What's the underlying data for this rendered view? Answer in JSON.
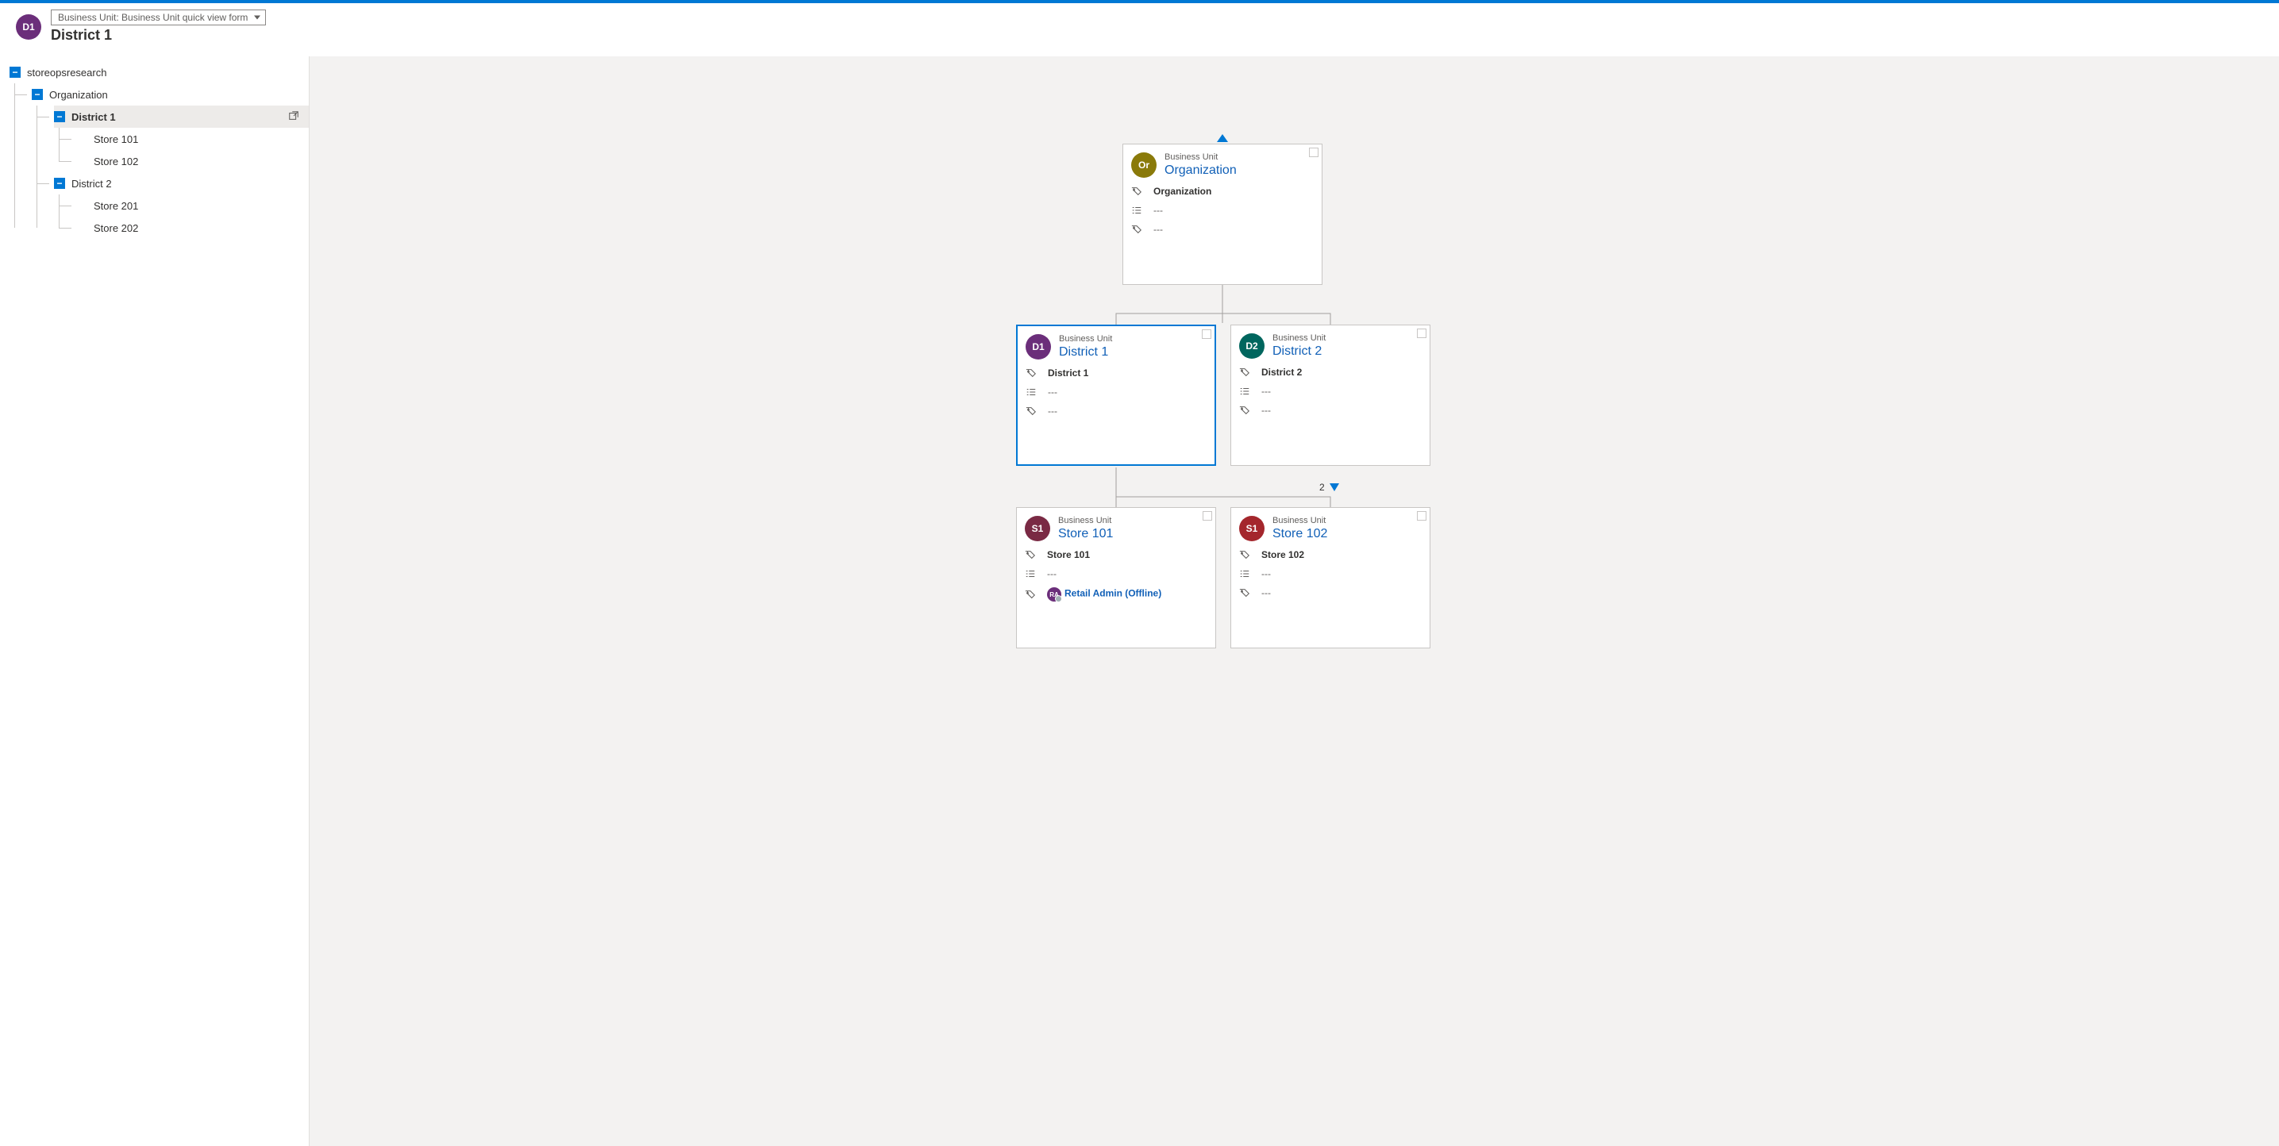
{
  "header": {
    "avatar_initials": "D1",
    "form_selector": "Business Unit: Business Unit quick view form",
    "title": "District 1"
  },
  "tree": {
    "root": "storeopsresearch",
    "organization": "Organization",
    "district1": "District 1",
    "store101": "Store 101",
    "store102": "Store 102",
    "district2": "District 2",
    "store201": "Store 201",
    "store202": "Store 202"
  },
  "hierarchy": {
    "type_label": "Business Unit",
    "dash": "---",
    "organization": {
      "initials": "Or",
      "title": "Organization",
      "name_value": "Organization"
    },
    "district1": {
      "initials": "D1",
      "title": "District 1",
      "name_value": "District 1"
    },
    "district2": {
      "initials": "D2",
      "title": "District 2",
      "name_value": "District 2"
    },
    "store101": {
      "initials": "S1",
      "title": "Store 101",
      "name_value": "Store 101",
      "admin_initials": "RA",
      "admin_label": "Retail Admin (Offline)"
    },
    "store102": {
      "initials": "S1",
      "title": "Store 102",
      "name_value": "Store 102"
    },
    "child_count": "2"
  }
}
